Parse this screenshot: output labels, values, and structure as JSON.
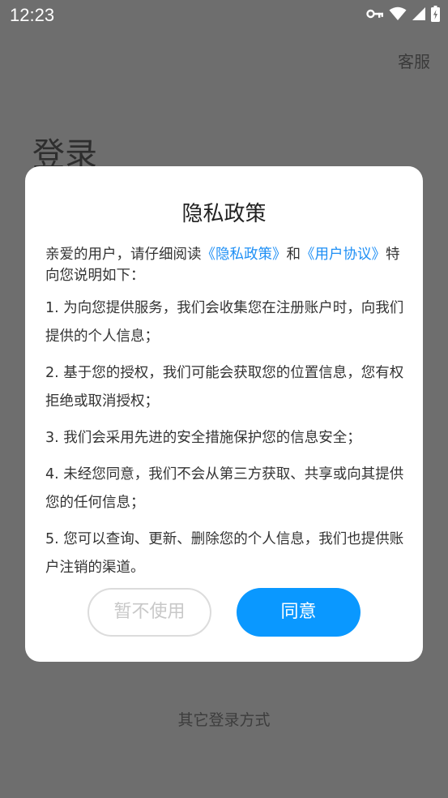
{
  "status_bar": {
    "time": "12:23",
    "icons": [
      "key-icon",
      "wifi-icon",
      "signal-icon",
      "battery-icon"
    ]
  },
  "header": {
    "service_label": "客服"
  },
  "login": {
    "title": "登录",
    "other_methods": "其它登录方式"
  },
  "dialog": {
    "title": "隐私政策",
    "intro_prefix": "亲爱的用户，请仔细阅读",
    "privacy_link": "《隐私政策》",
    "intro_and": "和",
    "agreement_link": "《用户协议》",
    "intro_suffix": "特向您说明如下：",
    "items": [
      "1. 为向您提供服务，我们会收集您在注册账户时，向我们提供的个人信息；",
      "2. 基于您的授权，我们可能会获取您的位置信息，您有权拒绝或取消授权；",
      "3. 我们会采用先进的安全措施保护您的信息安全；",
      "4. 未经您同意，我们不会从第三方获取、共享或向其提供您的任何信息；",
      "5. 您可以查询、更新、删除您的个人信息，我们也提供账户注销的渠道。"
    ],
    "decline_label": "暂不使用",
    "agree_label": "同意"
  },
  "colors": {
    "overlay": "#6e6e6e",
    "link": "#1e8ff5",
    "agree_button": "#0a98ff"
  }
}
